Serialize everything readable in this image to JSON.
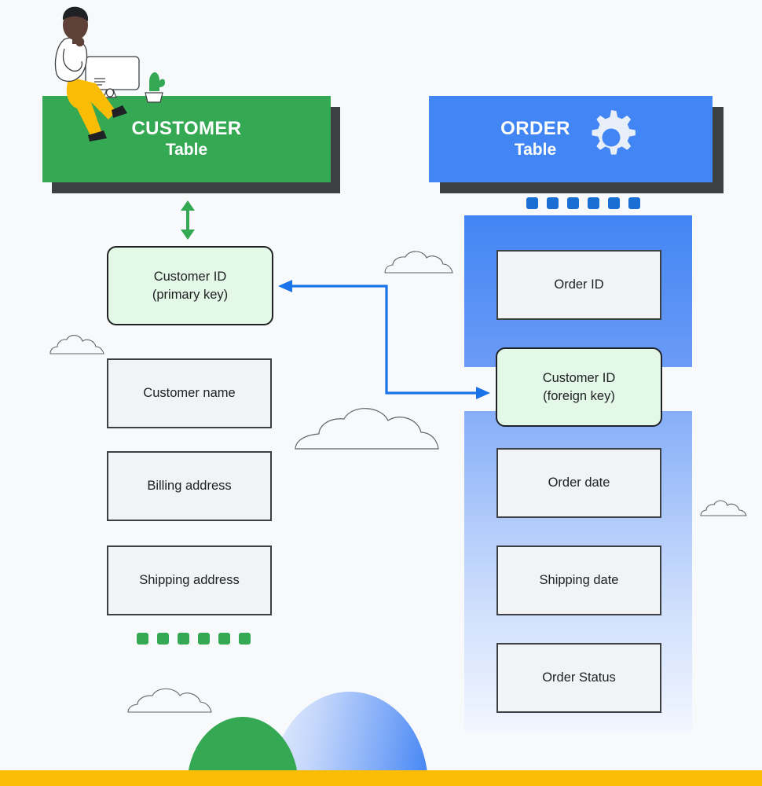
{
  "diagram": {
    "title_hidden": "",
    "background_color": "#f8f9fa",
    "accent_green": "#34a853",
    "accent_blue": "#4285f4",
    "accent_yellow": "#fbbc05",
    "shadow_color": "#3c4043",
    "key_fill": "#e3f8e6",
    "field_fill": "#f1f3f4"
  },
  "customer_table": {
    "header": {
      "title": "CUSTOMER",
      "subtitle": "Table"
    },
    "fields": [
      {
        "label": "Customer ID\n(primary key)",
        "line1": "Customer ID",
        "line2": "(primary key)",
        "is_key": true,
        "key_type": "primary key"
      },
      {
        "label": "Customer name",
        "line1": "Customer name",
        "line2": "",
        "is_key": false,
        "key_type": ""
      },
      {
        "label": "Billing address",
        "line1": "Billing address",
        "line2": "",
        "is_key": false,
        "key_type": ""
      },
      {
        "label": "Shipping address",
        "line1": "Shipping address",
        "line2": "",
        "is_key": false,
        "key_type": ""
      }
    ],
    "dot_count": 6
  },
  "order_table": {
    "header": {
      "title": "ORDER",
      "subtitle": "Table"
    },
    "fields": [
      {
        "label": "Order ID",
        "line1": "Order ID",
        "line2": "",
        "is_key": false,
        "key_type": ""
      },
      {
        "label": "Customer ID\n(foreign key)",
        "line1": "Customer ID",
        "line2": "(foreign key)",
        "is_key": true,
        "key_type": "foreign key"
      },
      {
        "label": "Order date",
        "line1": "Order date",
        "line2": "",
        "is_key": false,
        "key_type": ""
      },
      {
        "label": "Shipping date",
        "line1": "Shipping date",
        "line2": "",
        "is_key": false,
        "key_type": ""
      },
      {
        "label": "Order Status",
        "line1": "Order Status",
        "line2": "",
        "is_key": false,
        "key_type": ""
      }
    ],
    "dot_count": 6
  },
  "relationship": {
    "type": "one-to-many",
    "from": "CUSTOMER.Customer ID (primary key)",
    "to": "ORDER.Customer ID (foreign key)",
    "connector_color": "#1a73e8",
    "vertical_arrow_color": "#34a853"
  }
}
